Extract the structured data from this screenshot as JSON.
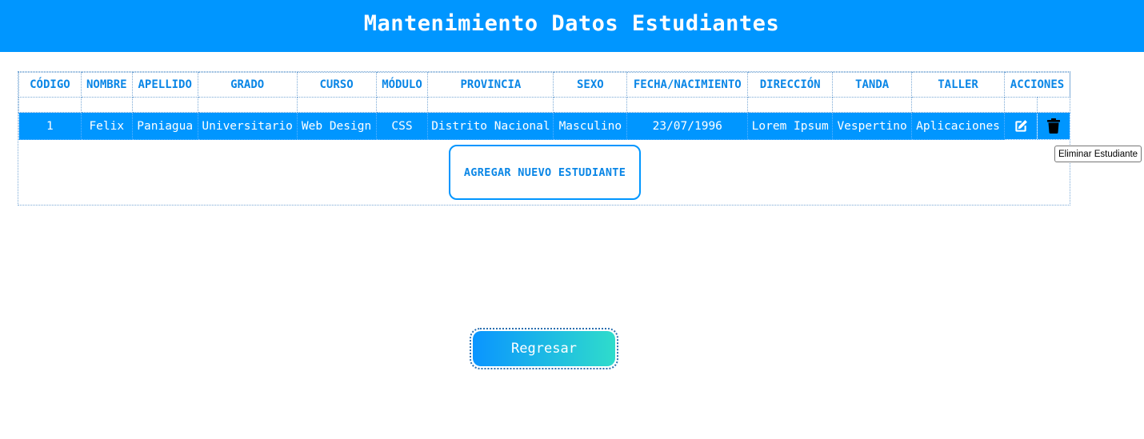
{
  "header": {
    "title": "Mantenimiento Datos Estudiantes"
  },
  "table": {
    "columns": [
      "CÓDIGO",
      "NOMBRE",
      "APELLIDO",
      "GRADO",
      "CURSO",
      "MÓDULO",
      "PROVINCIA",
      "SEXO",
      "FECHA/NACIMIENTO",
      "DIRECCIÓN",
      "TANDA",
      "TALLER",
      "ACCIONES"
    ],
    "rows": [
      {
        "codigo": "1",
        "nombre": "Felix",
        "apellido": "Paniagua",
        "grado": "Universitario",
        "curso": "Web Design",
        "modulo": "CSS",
        "provincia": "Distrito Nacional",
        "sexo": "Masculino",
        "fecha_nacimiento": "23/07/1996",
        "direccion": "Lorem Ipsum",
        "tanda": "Vespertino",
        "taller": "Aplicaciones",
        "actions": {
          "edit_icon": "edit-icon",
          "delete_icon": "trash-icon"
        }
      }
    ]
  },
  "add_button": {
    "label": "AGREGAR NUEVO ESTUDIANTE"
  },
  "tooltip": {
    "text": "Eliminar Estudiante"
  },
  "back_button": {
    "label": "Regresar"
  },
  "colors": {
    "primary": "#0096ff",
    "gradient_end": "#2fdccb",
    "header_text": "#0a86e6"
  }
}
